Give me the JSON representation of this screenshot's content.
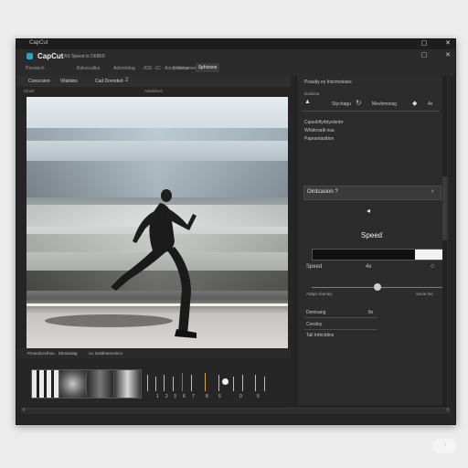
{
  "window": {
    "title": "CapCut"
  },
  "header": {
    "app_name": "CapCut",
    "app_subtitle": "AS Speed is O6B60",
    "menu": [
      "Pensiech",
      "Balvocalliur",
      "Adwolrdog",
      "·JOS ·1C · Aordomiiiou",
      "| Vocssmenc"
    ],
    "active_menu": "Sphiosos"
  },
  "tabs": {
    "items": [
      "Conocsion",
      "Vilatidos",
      "Cad Dovoded",
      "2"
    ]
  },
  "preview_labels": {
    "left": "Cinivt",
    "right": "Adstidnos"
  },
  "timeline": {
    "labels": [
      "Pzracdcecthoo",
      "Ebnandag",
      "co. Ealdmersoinco"
    ],
    "numbers": [
      "1",
      "2",
      "3",
      "6",
      "7",
      "8",
      "5",
      "0",
      "5"
    ]
  },
  "panel": {
    "title": "Prasdiy ey Inscmstoars",
    "subtitle": "Doniieur",
    "toolbar": [
      "Stychagu",
      "Mevkmonsg",
      "4x"
    ],
    "info_lines": [
      "Cqasdiifyrbtyolsnbr",
      "Whidcnatli nsa",
      "Paprantasttion"
    ],
    "section_label": "Oirdcasion ?",
    "speed_title": "Speed",
    "speed_label": "Speed",
    "speed_value": "4x",
    "speed_fraction": 0.22,
    "slider_left_label": "Adapt olomiey",
    "slider_right_label": "Sacle hio",
    "slider_fraction": 0.5,
    "list": [
      {
        "label": "Deninang",
        "value": "8x"
      },
      {
        "label": "Coraloy",
        "value": ""
      },
      {
        "label": "Tall Infectdins",
        "value": ""
      }
    ]
  },
  "colors": {
    "accent": "#2aa6c8",
    "background": "#252525",
    "panel": "#2c2c2c"
  },
  "watermark": "ㄱ"
}
